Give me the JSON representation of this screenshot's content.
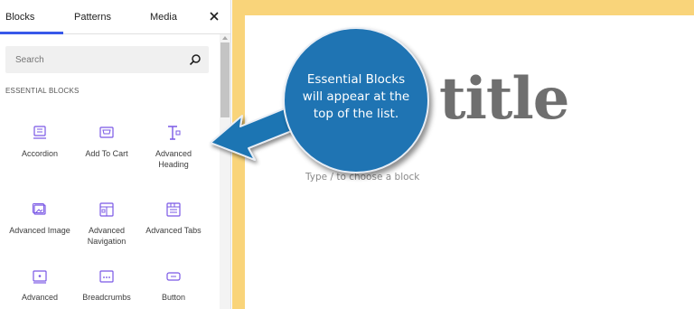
{
  "inserter": {
    "tabs": [
      {
        "label": "Blocks",
        "active": true
      },
      {
        "label": "Patterns",
        "active": false
      },
      {
        "label": "Media",
        "active": false
      }
    ],
    "close_icon": "close-icon",
    "search": {
      "placeholder": "Search",
      "icon": "search-icon"
    },
    "section_title": "ESSENTIAL BLOCKS",
    "blocks": [
      {
        "label": "Accordion",
        "icon": "accordion-icon"
      },
      {
        "label": "Add To Cart",
        "icon": "cart-icon"
      },
      {
        "label": "Advanced Heading",
        "icon": "heading-icon"
      },
      {
        "label": "Advanced Image",
        "icon": "image-icon"
      },
      {
        "label": "Advanced Navigation",
        "icon": "navigation-icon"
      },
      {
        "label": "Advanced Tabs",
        "icon": "tabs-icon"
      },
      {
        "label": "Advanced",
        "icon": "video-icon"
      },
      {
        "label": "Breadcrumbs",
        "icon": "breadcrumbs-icon"
      },
      {
        "label": "Button",
        "icon": "button-icon"
      }
    ],
    "accent_color": "#3858e9",
    "block_icon_color": "#7a58e5"
  },
  "editor": {
    "title_fragment": "title",
    "block_placeholder": "Type / to choose a block",
    "frame_color": "#f9d47a"
  },
  "callout": {
    "lines": [
      "Essential Blocks",
      "will appear at the",
      "top of the list."
    ],
    "color": "#1f74b3"
  }
}
